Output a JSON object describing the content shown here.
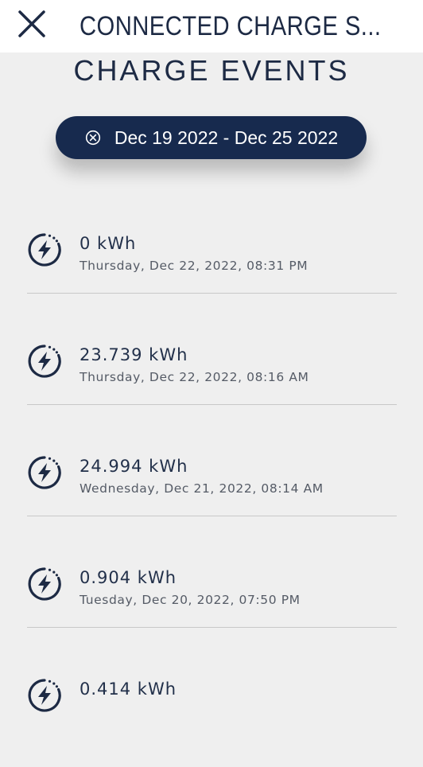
{
  "header": {
    "title": "CONNECTED CHARGE S...",
    "close_icon": "close-icon"
  },
  "section": {
    "title": "CHARGE EVENTS"
  },
  "date_filter": {
    "label": "Dec 19 2022 - Dec 25 2022",
    "icon": "clear-circle-icon"
  },
  "events": [
    {
      "kwh": "0 kWh",
      "datetime": "Thursday, Dec 22, 2022, 08:31 PM",
      "icon": "charge-bolt-icon"
    },
    {
      "kwh": "23.739 kWh",
      "datetime": "Thursday, Dec 22, 2022, 08:16 AM",
      "icon": "charge-bolt-icon"
    },
    {
      "kwh": "24.994 kWh",
      "datetime": "Wednesday, Dec 21, 2022, 08:14 AM",
      "icon": "charge-bolt-icon"
    },
    {
      "kwh": "0.904 kWh",
      "datetime": "Tuesday, Dec 20, 2022, 07:50 PM",
      "icon": "charge-bolt-icon"
    },
    {
      "kwh": "0.414 kWh",
      "datetime": "",
      "icon": "charge-bolt-icon"
    }
  ],
  "colors": {
    "primary_navy": "#172a4e",
    "background": "#efefef",
    "header_bg": "#ffffff",
    "divider": "#c8c8c8"
  }
}
